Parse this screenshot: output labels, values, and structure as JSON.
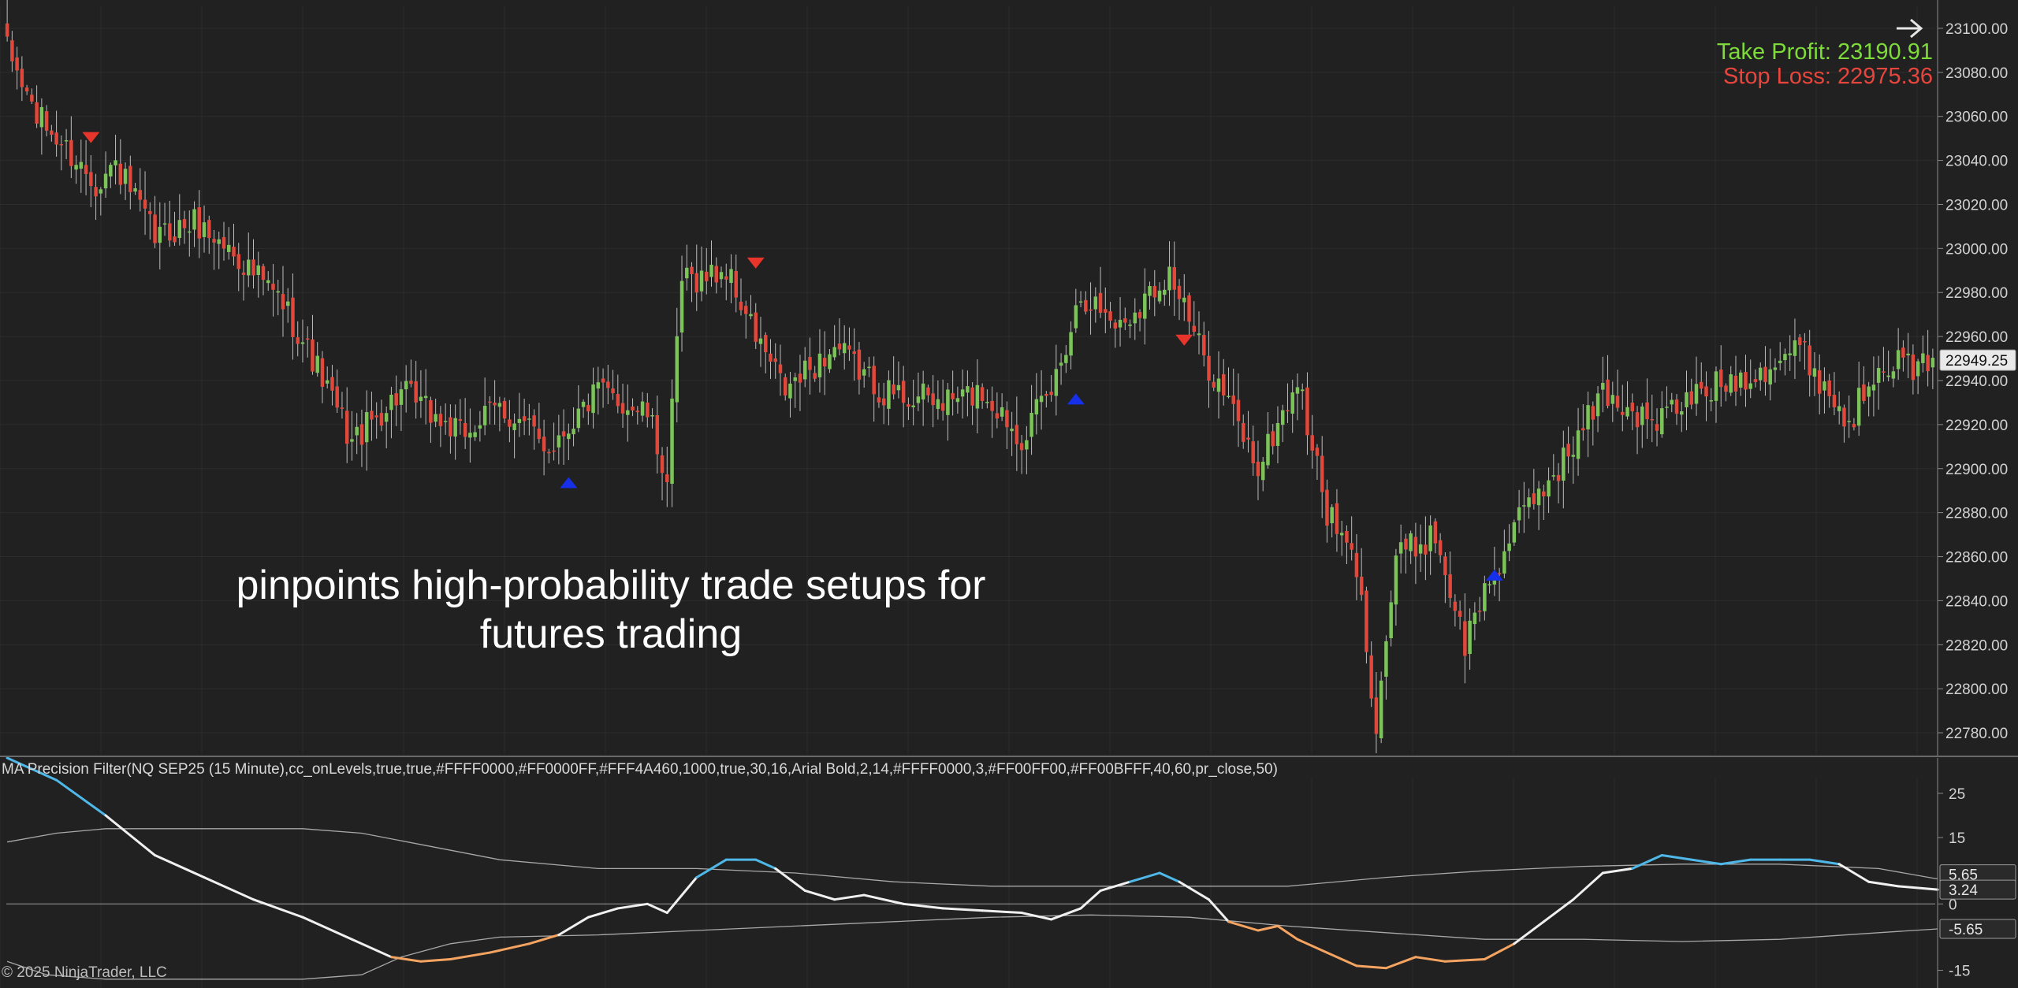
{
  "chart_data": [
    {
      "type": "candlestick",
      "instrument": "NQ SEP25 (15 Minute)",
      "ylim": [
        22770,
        23110
      ],
      "y_ticks": [
        23100,
        23080,
        23060,
        23040,
        23020,
        23000,
        22980,
        22960,
        22940,
        22920,
        22900,
        22880,
        22860,
        22840,
        22820,
        22800,
        22780
      ],
      "y_tick_labels": [
        "23100.00",
        "23080.00",
        "23060.00",
        "23040.00",
        "23020.00",
        "23000.00",
        "22980.00",
        "22960.00",
        "22940.00",
        "22920.00",
        "22900.00",
        "22880.00",
        "22860.00",
        "22840.00",
        "22820.00",
        "22800.00",
        "22780.00"
      ],
      "current_price_label": "22949.25",
      "current_price": 22949.25,
      "grid": true,
      "take_profit_label": "Take Profit: 23190.91",
      "stop_loss_label": "Stop Loss: 22975.36",
      "annotation": "pinpoints high-probability trade setups for futures trading",
      "up_color": "#7cc35a",
      "down_color": "#e0483c",
      "anchors": [
        [
          0,
          23090
        ],
        [
          6,
          23060
        ],
        [
          12,
          23045
        ],
        [
          18,
          23030
        ],
        [
          22,
          23038
        ],
        [
          30,
          23005
        ],
        [
          38,
          23012
        ],
        [
          46,
          22998
        ],
        [
          56,
          22975
        ],
        [
          62,
          22950
        ],
        [
          70,
          22912
        ],
        [
          80,
          22935
        ],
        [
          92,
          22915
        ],
        [
          100,
          22928
        ],
        [
          110,
          22910
        ],
        [
          120,
          22935
        ],
        [
          130,
          22925
        ],
        [
          134,
          22895
        ],
        [
          137,
          22985
        ],
        [
          146,
          22990
        ],
        [
          152,
          22960
        ],
        [
          158,
          22935
        ],
        [
          168,
          22955
        ],
        [
          178,
          22935
        ],
        [
          190,
          22930
        ],
        [
          198,
          22935
        ],
        [
          206,
          22915
        ],
        [
          212,
          22935
        ],
        [
          218,
          22980
        ],
        [
          226,
          22965
        ],
        [
          236,
          22990
        ],
        [
          242,
          22955
        ],
        [
          248,
          22930
        ],
        [
          254,
          22900
        ],
        [
          262,
          22940
        ],
        [
          268,
          22880
        ],
        [
          274,
          22855
        ],
        [
          278,
          22785
        ],
        [
          282,
          22860
        ],
        [
          290,
          22870
        ],
        [
          296,
          22820
        ],
        [
          300,
          22845
        ],
        [
          308,
          22880
        ],
        [
          318,
          22910
        ],
        [
          324,
          22935
        ],
        [
          334,
          22920
        ],
        [
          344,
          22935
        ],
        [
          356,
          22945
        ],
        [
          364,
          22955
        ],
        [
          374,
          22920
        ],
        [
          380,
          22950
        ],
        [
          390,
          22945
        ]
      ],
      "signals": [
        {
          "bar": 17,
          "dir": "sell",
          "price": 23050
        },
        {
          "bar": 114,
          "dir": "buy",
          "price": 22894
        },
        {
          "bar": 152,
          "dir": "sell",
          "price": 22993
        },
        {
          "bar": 217,
          "dir": "buy",
          "price": 22932
        },
        {
          "bar": 239,
          "dir": "sell",
          "price": 22958
        },
        {
          "bar": 302,
          "dir": "buy",
          "price": 22852
        }
      ]
    },
    {
      "type": "line",
      "title": "MA Precision Filter(NQ SEP25 (15 Minute),cc_onLevels,true,true,#FFFF0000,#FF0000FF,#FFF4A460,1000,true,30,16,Arial Bold,2,14,#FFFF0000,3,#FF00FF00,#FF00BFFF,40,60,pr_close,50)",
      "ylim": [
        -19,
        33
      ],
      "y_ticks": [
        25,
        15,
        0,
        -15
      ],
      "y_tick_labels": [
        "25",
        "15",
        "0",
        "-15"
      ],
      "value_labels": [
        "5.65",
        "3.24",
        "-5.65"
      ],
      "series": [
        {
          "color": "#f0f0f0",
          "up_color": "#4fb8e8",
          "down_color": "#f4a460",
          "points": [
            [
              0,
              33
            ],
            [
              10,
              28
            ],
            [
              20,
              20
            ],
            [
              30,
              11
            ],
            [
              40,
              6
            ],
            [
              50,
              1
            ],
            [
              60,
              -3
            ],
            [
              70,
              -8
            ],
            [
              78,
              -12
            ],
            [
              84,
              -13
            ],
            [
              90,
              -12.5
            ],
            [
              98,
              -11
            ],
            [
              106,
              -9
            ],
            [
              112,
              -7
            ],
            [
              118,
              -3
            ],
            [
              124,
              -1
            ],
            [
              130,
              0
            ],
            [
              134,
              -2
            ],
            [
              140,
              6
            ],
            [
              146,
              10
            ],
            [
              152,
              10
            ],
            [
              156,
              8
            ],
            [
              162,
              3
            ],
            [
              168,
              1
            ],
            [
              174,
              2
            ],
            [
              182,
              0
            ],
            [
              190,
              -1
            ],
            [
              198,
              -1.5
            ],
            [
              206,
              -2
            ],
            [
              212,
              -3.5
            ],
            [
              218,
              -1
            ],
            [
              222,
              3
            ],
            [
              228,
              5
            ],
            [
              234,
              7
            ],
            [
              238,
              5
            ],
            [
              244,
              1
            ],
            [
              248,
              -4
            ],
            [
              254,
              -6
            ],
            [
              258,
              -5
            ],
            [
              262,
              -8
            ],
            [
              268,
              -11
            ],
            [
              274,
              -14
            ],
            [
              280,
              -14.5
            ],
            [
              286,
              -12
            ],
            [
              292,
              -13
            ],
            [
              300,
              -12.5
            ],
            [
              306,
              -9
            ],
            [
              312,
              -4
            ],
            [
              318,
              1
            ],
            [
              324,
              7
            ],
            [
              330,
              8
            ],
            [
              336,
              11
            ],
            [
              342,
              10
            ],
            [
              348,
              9
            ],
            [
              354,
              10
            ],
            [
              360,
              10
            ],
            [
              366,
              10
            ],
            [
              372,
              9
            ],
            [
              378,
              5
            ],
            [
              384,
              4
            ],
            [
              392,
              3.24
            ]
          ]
        },
        {
          "color": "#a8a8a8",
          "points": [
            [
              0,
              14
            ],
            [
              10,
              16
            ],
            [
              20,
              17
            ],
            [
              40,
              17
            ],
            [
              60,
              17
            ],
            [
              72,
              16
            ],
            [
              86,
              13
            ],
            [
              100,
              10
            ],
            [
              120,
              8
            ],
            [
              140,
              8
            ],
            [
              160,
              7
            ],
            [
              180,
              5
            ],
            [
              200,
              4
            ],
            [
              220,
              4
            ],
            [
              240,
              4
            ],
            [
              260,
              4
            ],
            [
              280,
              6
            ],
            [
              300,
              7.5
            ],
            [
              320,
              8.5
            ],
            [
              340,
              9
            ],
            [
              360,
              9
            ],
            [
              380,
              8
            ],
            [
              392,
              5.65
            ]
          ]
        },
        {
          "color": "#a8a8a8",
          "points": [
            [
              0,
              -13
            ],
            [
              8,
              -16
            ],
            [
              20,
              -17
            ],
            [
              40,
              -17
            ],
            [
              60,
              -17
            ],
            [
              72,
              -16
            ],
            [
              80,
              -12
            ],
            [
              90,
              -9
            ],
            [
              100,
              -7.5
            ],
            [
              120,
              -7
            ],
            [
              140,
              -6
            ],
            [
              160,
              -5
            ],
            [
              180,
              -4
            ],
            [
              200,
              -3
            ],
            [
              220,
              -2.5
            ],
            [
              240,
              -3
            ],
            [
              260,
              -5
            ],
            [
              280,
              -6.5
            ],
            [
              300,
              -8
            ],
            [
              320,
              -8
            ],
            [
              340,
              -8.5
            ],
            [
              360,
              -8
            ],
            [
              380,
              -6.5
            ],
            [
              392,
              -5.65
            ]
          ]
        }
      ]
    }
  ],
  "copyright": "© 2025 NinjaTrader, LLC",
  "nav": {
    "arrow_icon": "arrow-right-icon"
  }
}
